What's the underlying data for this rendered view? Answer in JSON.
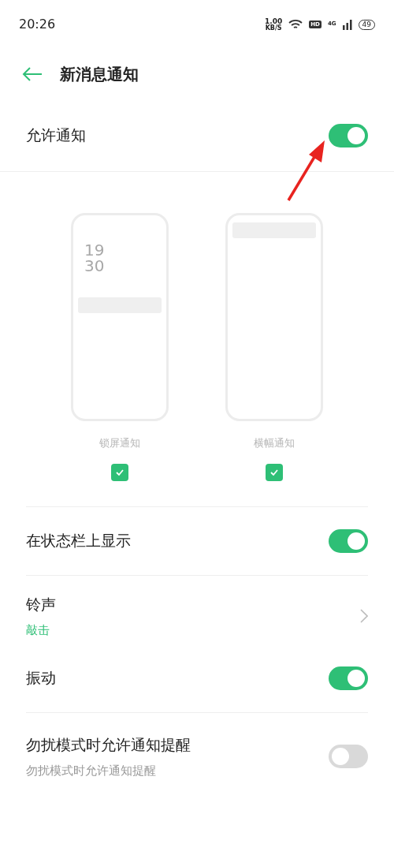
{
  "status_bar": {
    "time": "20:26",
    "speed": "1.00",
    "speed_unit": "KB/S",
    "hd": "HD",
    "network": "4G",
    "battery": "49"
  },
  "header": {
    "title": "新消息通知"
  },
  "allow": {
    "label": "允许通知",
    "on": true
  },
  "styles": [
    {
      "label": "锁屏通知",
      "kind": "lockscreen",
      "checked": true,
      "hour": "19",
      "minute": "30"
    },
    {
      "label": "横幅通知",
      "kind": "banner",
      "checked": true
    }
  ],
  "rows": [
    {
      "kind": "toggle",
      "label": "在状态栏上显示",
      "on": true,
      "divider": true
    },
    {
      "kind": "link",
      "label": "铃声",
      "value": "敲击",
      "divider": false
    },
    {
      "kind": "toggle",
      "label": "振动",
      "on": true,
      "divider": true
    },
    {
      "kind": "toggle",
      "label": "勿扰模式时允许通知提醒",
      "sub": "勿扰模式时允许通知提醒",
      "on": false,
      "divider": false
    }
  ]
}
